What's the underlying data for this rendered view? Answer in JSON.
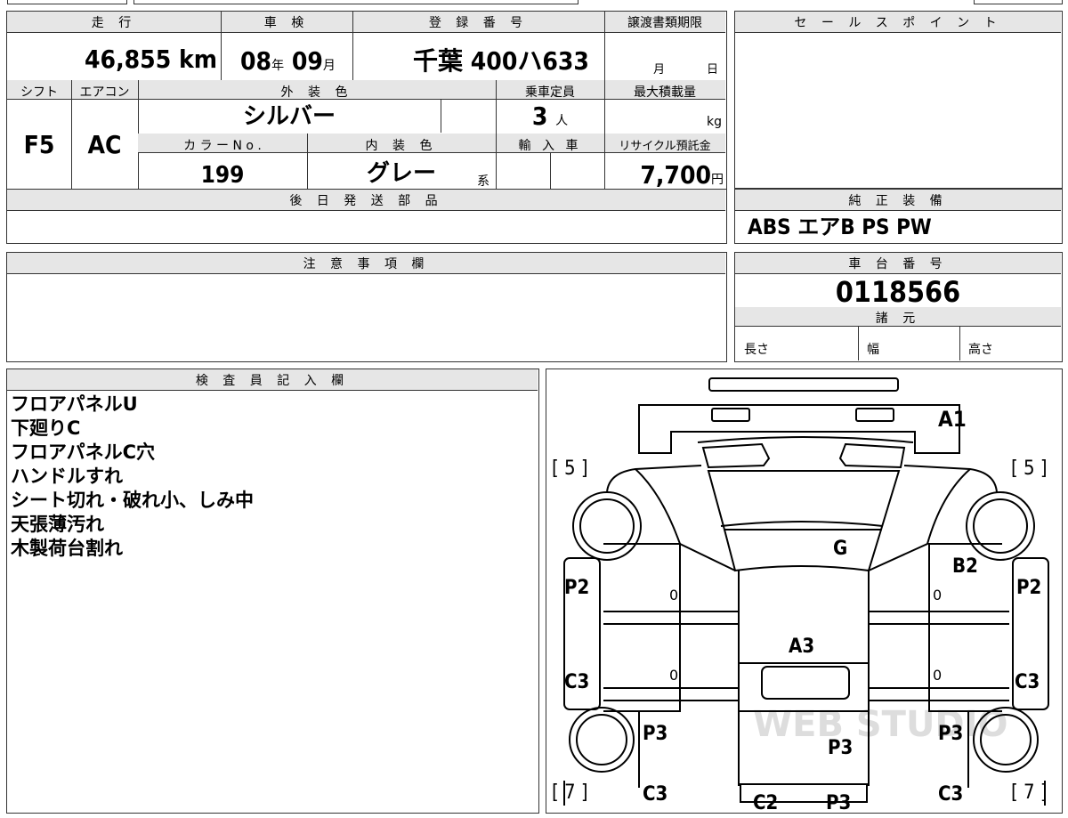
{
  "info": {
    "mileage_label": "走 行",
    "mileage_value": "46,855",
    "mileage_unit": "km",
    "shaken_label": "車 検",
    "shaken_year": "08",
    "shaken_year_unit": "年",
    "shaken_month": "09",
    "shaken_month_unit": "月",
    "reg_label": "登 録 番 号",
    "reg_area": "千葉",
    "reg_number": "400ハ633",
    "transfer_label": "譲渡書類期限",
    "transfer_month": "月",
    "transfer_day": "日",
    "shift_label": "シフト",
    "shift_value": "F5",
    "aircon_label": "エアコン",
    "aircon_value": "AC",
    "exterior_label": "外 装 色",
    "exterior_value": "シルバー",
    "capacity_label": "乗車定員",
    "capacity_value": "3",
    "capacity_unit": "人",
    "load_label": "最大積載量",
    "load_unit": "kg",
    "color_no_label": "カ ラ ー N o .",
    "color_no_value": "199",
    "interior_label": "内 装 色",
    "interior_value": "グレー",
    "interior_suffix": "系",
    "import_label": "輸 入 車",
    "recycle_label": "リサイクル預託金",
    "recycle_value": "7,700",
    "recycle_unit": "円",
    "parts_label": "後 日 発 送 部 品"
  },
  "sales_point": {
    "label": "セ ー ル ス ポ イ ン ト"
  },
  "equipment": {
    "label": "純 正 装 備",
    "value": "ABS エアB PS PW"
  },
  "caution": {
    "label": "注 意 事 項 欄"
  },
  "chassis": {
    "label": "車 台 番 号",
    "value": "0118566",
    "specs_label": "諸 元",
    "length_label": "長さ",
    "width_label": "幅",
    "height_label": "高さ"
  },
  "inspector": {
    "label": "検 査 員 記 入 欄",
    "notes": [
      "フロアパネルU",
      "下廻りC",
      "フロアパネルC穴",
      "ハンドルすれ",
      "シート切れ・破れ小、しみ中",
      "天張薄汚れ",
      "木製荷台割れ"
    ]
  },
  "diagram": {
    "marks": {
      "a1": "A1",
      "g": "G",
      "b2": "B2",
      "a3": "A3",
      "p2_left": "P2",
      "p2_right": "P2",
      "c3_left": "C3",
      "c3_right": "C3",
      "p3_left": "P3",
      "p3_center": "P3",
      "p3_right": "P3",
      "c3_bottom_left": "C3",
      "c3_bottom_right": "C3",
      "c2_bottom": "C2",
      "p3_bottom": "P3",
      "zero_1": "0",
      "zero_2": "0",
      "zero_3": "0",
      "zero_4": "0"
    },
    "tires": {
      "front_left": "[ 5 ]",
      "front_right": "[ 5 ]",
      "rear_left": "[ 7 ]",
      "rear_right": "[ 7 ]"
    },
    "watermark": "WEB STUDIO"
  }
}
